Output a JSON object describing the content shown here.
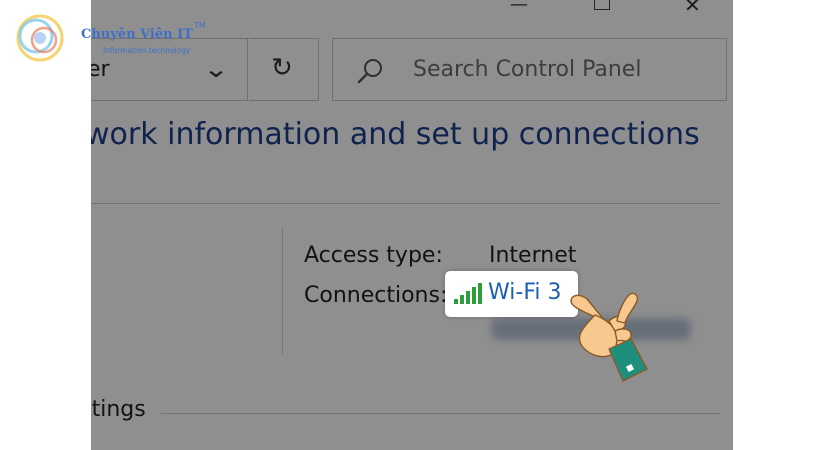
{
  "window": {
    "minimize_glyph": "—",
    "close_glyph": "✕"
  },
  "address_bar": {
    "text": "er",
    "dropdown_icon": "chevron-down-icon",
    "refresh_icon": "refresh-icon",
    "refresh_glyph": "↻"
  },
  "search": {
    "placeholder": "Search Control Panel",
    "icon": "search-icon"
  },
  "heading": "work information and set up connections",
  "network": {
    "access_type_label": "Access type:",
    "access_type_value": "Internet",
    "connections_label": "Connections:",
    "connection_name": "Wi-Fi 3",
    "signal_icon": "wifi-signal-icon"
  },
  "section": {
    "change_settings": "ttings"
  },
  "watermark": {
    "name": "Chuyên Viên IT",
    "tm": "TM",
    "tagline": "Information technology"
  },
  "colors": {
    "heading": "#1e3f8c",
    "link": "#1a5fb4",
    "signal": "#2e9e3a",
    "hand_skin": "#f7c98e",
    "hand_cuff": "#1e8f7a",
    "watermark": "#3f6fc9"
  }
}
